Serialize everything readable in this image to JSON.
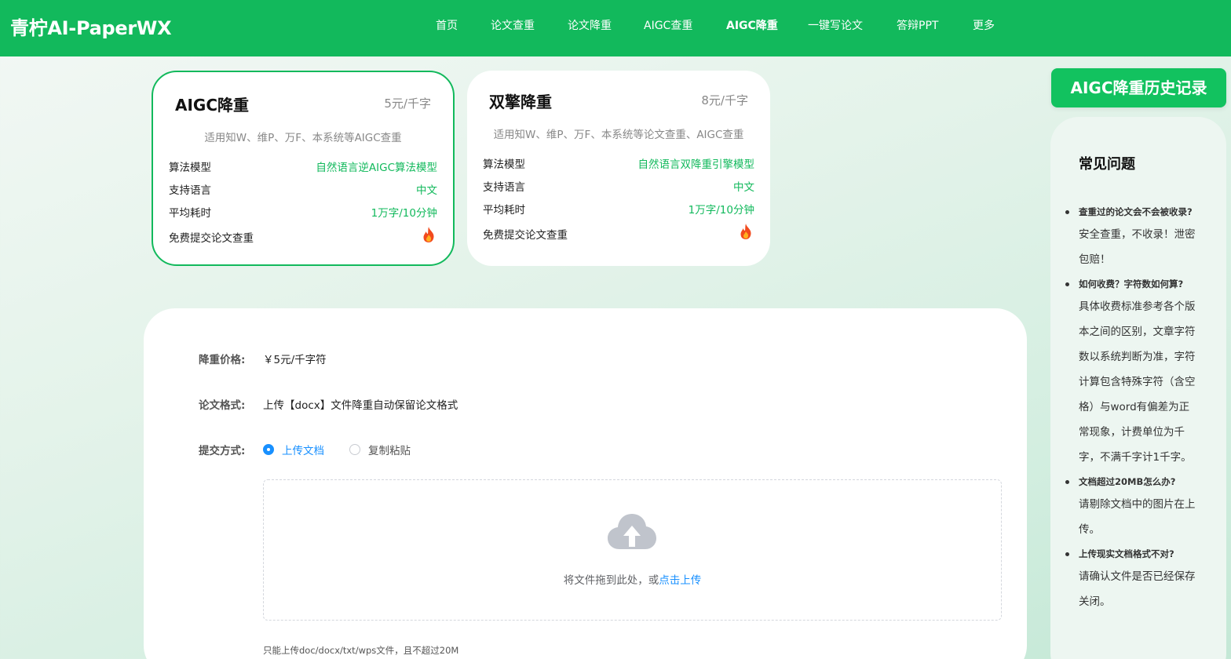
{
  "header": {
    "logo": "青柠AI-PaperWX",
    "nav": [
      "首页",
      "论文查重",
      "论文降重",
      "AIGC查重",
      "AIGC降重",
      "一键写论文",
      "答辩PPT",
      "更多"
    ],
    "active_index": 4
  },
  "plans": [
    {
      "name": "AIGC降重",
      "price": "5元/千字",
      "desc": "适用知W、维P、万F、本系统等AIGC查重",
      "selected": true,
      "features": [
        {
          "key": "算法模型",
          "value": "自然语言逆AIGC算法模型"
        },
        {
          "key": "支持语言",
          "value": "中文"
        },
        {
          "key": "平均耗时",
          "value": "1万字/10分钟"
        },
        {
          "key": "免费提交论文查重",
          "value": ""
        }
      ]
    },
    {
      "name": "双擎降重",
      "price": "8元/千字",
      "desc": "适用知W、维P、万F、本系统等论文查重、AIGC查重",
      "selected": false,
      "features": [
        {
          "key": "算法模型",
          "value": "自然语言双降重引擎模型"
        },
        {
          "key": "支持语言",
          "value": "中文"
        },
        {
          "key": "平均耗时",
          "value": "1万字/10分钟"
        },
        {
          "key": "免费提交论文查重",
          "value": ""
        }
      ]
    }
  ],
  "form": {
    "price_label": "降重价格:",
    "price_value": "￥5元/千字符",
    "format_label": "论文格式:",
    "format_value": "上传【docx】文件降重自动保留论文格式",
    "method_label": "提交方式:",
    "method_options": [
      "上传文档",
      "复制粘贴"
    ],
    "method_selected": 0,
    "drop_text": "将文件拖到此处，或",
    "drop_link": "点击上传",
    "hint": "只能上传doc/docx/txt/wps文件，且不超过20M"
  },
  "sidebar": {
    "history_button": "AIGC降重历史记录",
    "faq_title": "常见问题",
    "faq": [
      {
        "q": "查重过的论文会不会被收录?",
        "a": "安全查重，不收录！泄密包赔！"
      },
      {
        "q": "如何收费？字符数如何算?",
        "a": "具体收费标准参考各个版本之间的区别，文章字符数以系统判断为准，字符计算包含特殊字符（含空格）与word有偏差为正常现象，计费单位为千字，不满千字计1千字。"
      },
      {
        "q": "文档超过20MB怎么办?",
        "a": "请剔除文档中的图片在上传。"
      },
      {
        "q": "上传现实文档格式不对?",
        "a": "请确认文件是否已经保存关闭。"
      }
    ]
  },
  "colors": {
    "brand": "#12b95c",
    "link": "#1890ff"
  },
  "icons": {
    "fire": "fire-icon",
    "upload": "cloud-upload-icon"
  }
}
